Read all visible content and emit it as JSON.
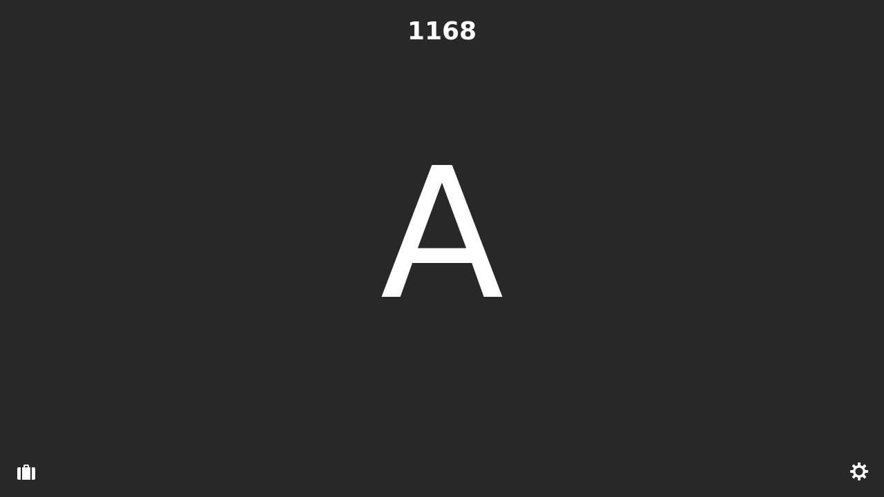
{
  "game": {
    "score": "1168",
    "current_letter": "A"
  },
  "toolbar": {
    "left_icon": "briefcase-icon",
    "right_icon": "gear-icon"
  },
  "colors": {
    "background": "#282828",
    "foreground": "#ffffff"
  }
}
